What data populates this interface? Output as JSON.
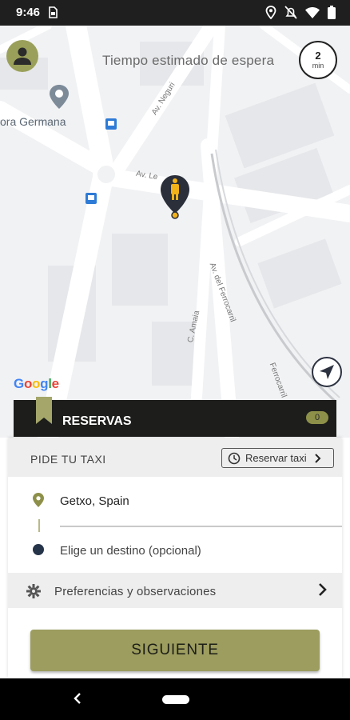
{
  "status_bar": {
    "time": "9:46",
    "icons": [
      "sim-icon",
      "location-icon",
      "notifications-off-icon",
      "wifi-icon",
      "battery-icon"
    ]
  },
  "map": {
    "wait_label": "Tiempo estimado de espera",
    "wait_value": "2",
    "wait_unit": "min",
    "place_label": "ora Germana",
    "streets": [
      "Av. Neguri",
      "Av. Le",
      "Av. del Ferrocarril",
      "C. Amaia",
      "Ferrocarril"
    ],
    "google_logo": "Google",
    "colors": {
      "pin": "#2a2f3a",
      "pin_figure": "#f2b21a",
      "road": "#ffffff",
      "land": "#f1f2f4"
    }
  },
  "reservas": {
    "label": "RESERVAS",
    "count": "0",
    "accent": "#8d9049"
  },
  "booking": {
    "title": "PIDE TU TAXI",
    "reservar_label": "Reservar taxi",
    "origin": "Getxo, Spain",
    "destination_placeholder": "Elige un destino (opcional)",
    "preferences_label": "Preferencias y observaciones",
    "submit_label": "SIGUIENTE",
    "submit_color": "#9c9d5f"
  }
}
